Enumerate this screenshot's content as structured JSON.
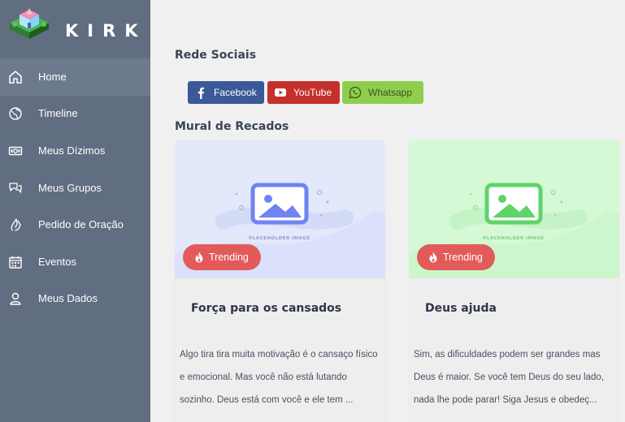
{
  "brand": {
    "name": "KIRK"
  },
  "sidebar": {
    "items": [
      {
        "label": "Home",
        "icon": "home-icon",
        "active": true
      },
      {
        "label": "Timeline",
        "icon": "globe-icon"
      },
      {
        "label": "Meus Dízimos",
        "icon": "money-icon"
      },
      {
        "label": "Meus Grupos",
        "icon": "chat-bubbles-icon"
      },
      {
        "label": "Pedido de Oração",
        "icon": "praying-hands-icon"
      },
      {
        "label": "Eventos",
        "icon": "calendar-icon"
      },
      {
        "label": "Meus Dados",
        "icon": "user-icon"
      }
    ]
  },
  "social": {
    "title": "Rede Sociais",
    "facebook": {
      "label": "Facebook",
      "color": "#3b5998"
    },
    "youtube": {
      "label": "YouTube",
      "color": "#c4302b"
    },
    "whatsapp": {
      "label": "Whatsapp",
      "color": "#8fce4c"
    }
  },
  "mural": {
    "title": "Mural de Recados",
    "cards": [
      {
        "badge": "Trending",
        "image_text": "PLACEHOLDER IMAGE",
        "image_tint": "#e3e8fb",
        "title": "Força para os cansados",
        "text": "Algo tira tira muita motivação é o cansaço físico e emocional. Mas você não está lutando sozinho. Deus está com você e ele tem ..."
      },
      {
        "badge": "Trending",
        "image_text": "PLACEHOLDER IMAGE",
        "image_tint": "#d4f9d4",
        "title": "Deus ajuda",
        "text": "Sim, as dificuldades podem ser grandes mas Deus é maior. Se você tem Deus do seu lado, nada lhe pode parar! Siga Jesus e obedeç..."
      }
    ]
  },
  "colors": {
    "sidebar": "#616d80",
    "active_item": "#6d7a8e",
    "badge": "#e35a5a"
  }
}
